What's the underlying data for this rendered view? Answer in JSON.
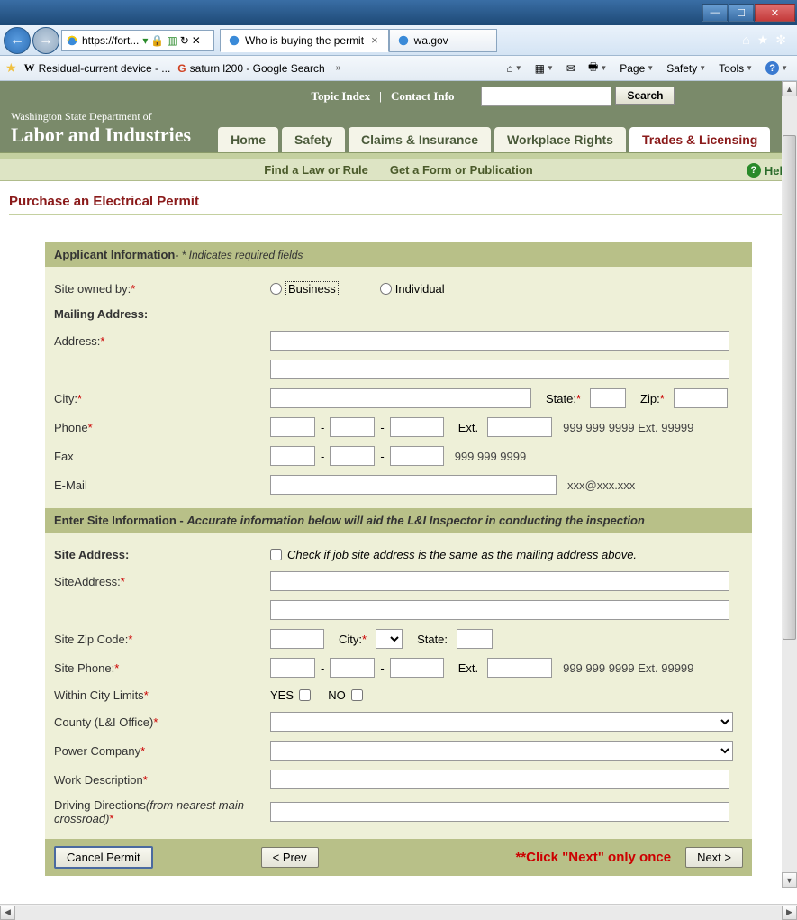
{
  "window": {
    "min": "—",
    "max": "☐",
    "close": "✕"
  },
  "browser": {
    "url_display": "https://fort...",
    "url_lock": "🔒",
    "tabs": [
      {
        "title": "Who is buying the permit",
        "active": true
      },
      {
        "title": "wa.gov",
        "active": false
      }
    ],
    "corner": {
      "home": "⌂",
      "star": "★",
      "gear": "✼"
    }
  },
  "favorites": {
    "links": [
      {
        "icon": "W",
        "text": "Residual-current device - ..."
      },
      {
        "icon": "G",
        "text": "saturn l200 - Google Search"
      }
    ]
  },
  "cmdbar": {
    "home": "⌂",
    "feeds": "▦",
    "mail": "✉",
    "print": "🖶",
    "page": "Page",
    "safety": "Safety",
    "tools": "Tools",
    "help": "?"
  },
  "site": {
    "top_links": {
      "topic_index": "Topic Index",
      "sep": "|",
      "contact": "Contact Info",
      "search_btn": "Search"
    },
    "logo": {
      "line1": "Washington State Department of",
      "line2": "Labor and Industries"
    },
    "tabs": [
      "Home",
      "Safety",
      "Claims & Insurance",
      "Workplace Rights",
      "Trades & Licensing"
    ],
    "active_tab": 4,
    "sub_links": [
      "Find a Law or Rule",
      "Get a Form or Publication"
    ],
    "help": "Help"
  },
  "page_title": "Purchase an Electrical Permit",
  "sec1": {
    "head": "Applicant Information",
    "note": "- * Indicates required fields",
    "owned_by": "Site owned by:",
    "opt_business": "Business",
    "opt_individual": "Individual",
    "mailing": "Mailing Address:",
    "address": "Address:",
    "city": "City:",
    "state": "State:",
    "zip": "Zip:",
    "phone": "Phone",
    "ext": "Ext.",
    "phone_hint": "999 999 9999 Ext. 99999",
    "fax": "Fax",
    "fax_hint": "999 999 9999",
    "email": "E-Mail",
    "email_hint": "xxx@xxx.xxx"
  },
  "sec2": {
    "head": "Enter Site Information - ",
    "head_note": "Accurate information below will aid the L&I Inspector in conducting the inspection",
    "site_address_lbl": "Site Address:",
    "same_check": "Check if job site address is the same as the mailing address above.",
    "siteaddress": "SiteAddress:",
    "site_zip": "Site Zip Code:",
    "city": "City:",
    "state": "State:",
    "site_phone": "Site Phone:",
    "ext": "Ext.",
    "phone_hint": "999 999 9999 Ext. 99999",
    "within_limits": "Within City Limits",
    "yes": "YES",
    "no": "NO",
    "county": "County (L&I Office)",
    "power": "Power Company",
    "work_desc": "Work Description",
    "directions": "Driving Directions",
    "directions_note": "(from nearest main crossroad)"
  },
  "buttons": {
    "cancel": "Cancel Permit",
    "prev": "< Prev",
    "warn": "**Click \"Next\" only once",
    "next": "Next >"
  }
}
